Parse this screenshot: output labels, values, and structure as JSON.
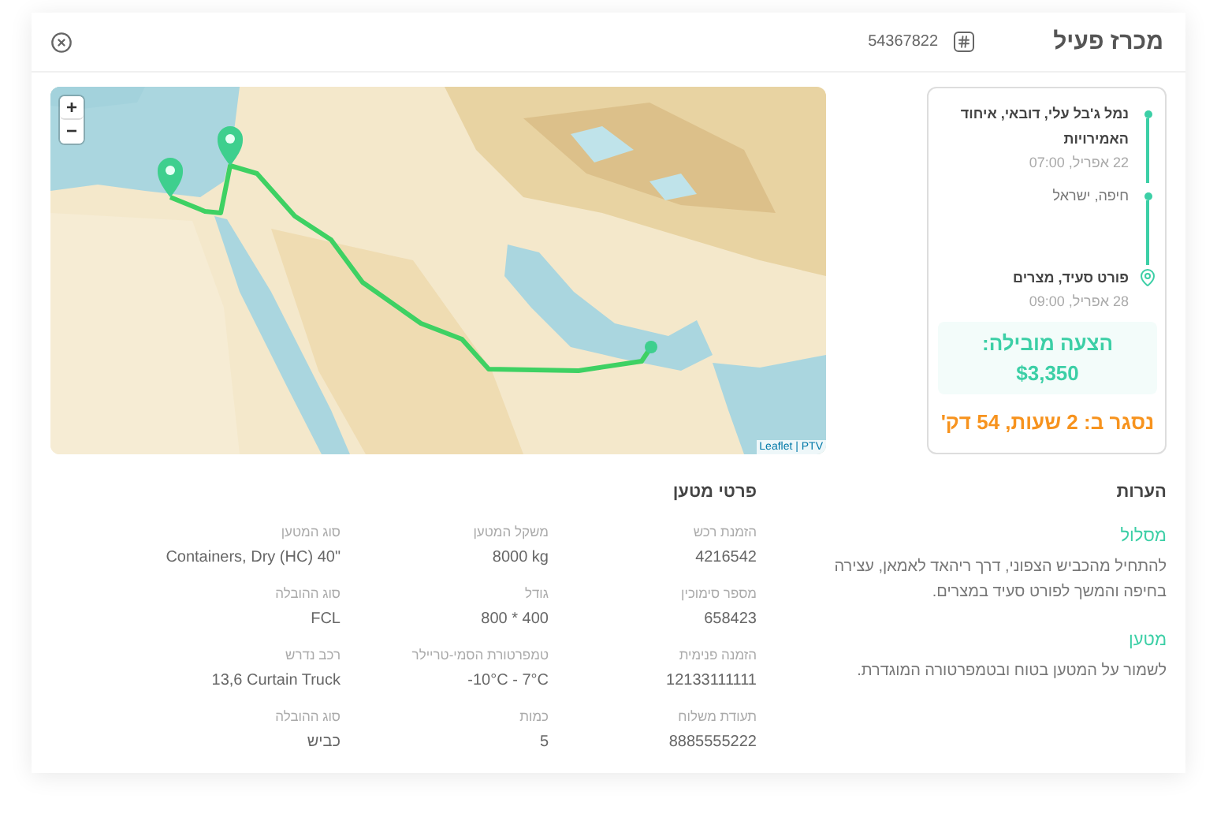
{
  "header": {
    "title": "מכרז פעיל",
    "tender_number": "54367822"
  },
  "route": {
    "stops": [
      {
        "kind": "origin",
        "place": "נמל ג'בל עלי, דובאי, איחוד האמירויות",
        "time": "22 אפריל, 07:00"
      },
      {
        "kind": "waypoint",
        "place": "חיפה, ישראל"
      },
      {
        "kind": "destination",
        "place": "פורט סעיד, מצרים",
        "time": "28 אפריל, 09:00"
      }
    ],
    "offer": {
      "label": "הצעה מובילה:",
      "price": "$3,350"
    },
    "closing": "נסגר ב: 2 שעות, 54 דק'"
  },
  "map": {
    "kind": "picture",
    "zoom_in": "+",
    "zoom_out": "−",
    "attribution": "Leaflet | PTV"
  },
  "notes": {
    "title": "הערות",
    "sections": [
      {
        "heading": "מסלול",
        "text": "להתחיל מהכביש הצפוני, דרך ריהאד לאמאן, עצירה בחיפה והמשך לפורט סעיד במצרים."
      },
      {
        "heading": "מטען",
        "text": "לשמור על המטען בטוח ובטמפרטורה המוגדרת."
      }
    ]
  },
  "cargo": {
    "title": "פרטי מטען",
    "fields": [
      {
        "label": "הזמנת רכש",
        "value": "4216542"
      },
      {
        "label": "משקל המטען",
        "value": "8000 kg"
      },
      {
        "label": "סוג המטען",
        "value": "Containers, Dry (HC) 40\""
      },
      {
        "label": "מספר סימוכין",
        "value": "658423"
      },
      {
        "label": "גודל",
        "value": "800 * 400"
      },
      {
        "label": "סוג ההובלה",
        "value": "FCL"
      },
      {
        "label": "הזמנה פנימית",
        "value": "12133111111"
      },
      {
        "label": "טמפרטורת הסמי-טריילר",
        "value": "-10°C - 7°C"
      },
      {
        "label": "רכב נדרש",
        "value": "13,6 Curtain Truck"
      },
      {
        "label": "תעודת משלוח",
        "value": "8885555222"
      },
      {
        "label": "כמות",
        "value": "5"
      },
      {
        "label": "סוג ההובלה",
        "value": "כביש"
      }
    ]
  }
}
